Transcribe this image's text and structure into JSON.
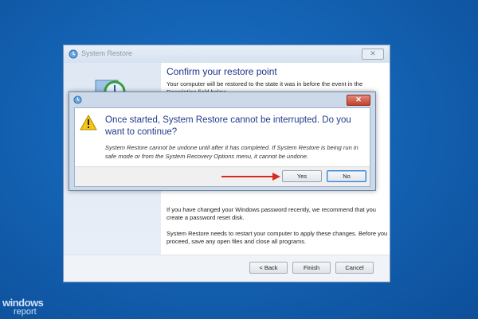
{
  "back_window": {
    "title": "System Restore",
    "close_label": "✕",
    "heading": "Confirm your restore point",
    "description": "Your computer will be restored to the state it was in before the event in the Description field below.",
    "password_note": "If you have changed your Windows password recently, we recommend that you create a password reset disk.",
    "restart_note": "System Restore needs to restart your computer to apply these changes. Before you proceed, save any open files and close all programs.",
    "buttons": {
      "back": "< Back",
      "finish": "Finish",
      "cancel": "Cancel"
    }
  },
  "dialog": {
    "close_label": "✕",
    "heading": "Once started, System Restore cannot be interrupted. Do you want to continue?",
    "message": "System Restore cannot be undone until after it has completed. If System Restore is being run in safe mode or from the System Recovery Options menu, it cannot be undone.",
    "buttons": {
      "yes": "Yes",
      "no": "No"
    }
  },
  "watermark": {
    "line1": "windows",
    "line2": "report"
  },
  "colors": {
    "desktop": "#1463b4",
    "heading_blue": "#1f3b8f",
    "arrow_red": "#d62b22",
    "warning_yellow": "#f5c518"
  },
  "icons": [
    "system-restore-icon",
    "restore-clock-icon",
    "warning-icon",
    "close-icon",
    "arrow-icon"
  ]
}
